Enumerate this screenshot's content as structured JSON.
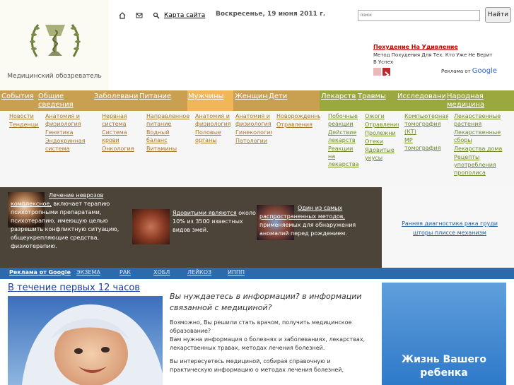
{
  "header": {
    "logo_text": "Медицинский обозреватель",
    "sitemap": "Карта сайта",
    "date": "Воскресенье, 19 июня 2011 г.",
    "search_placeholder": "поиск",
    "search_button": "Найти"
  },
  "ad_top": {
    "title": "Похудение На Удивление",
    "text": "Метод Похудения Для Тех. Кто Уже Не Верит В Успех",
    "by": "Реклама от",
    "brand": "Google"
  },
  "nav": [
    "События",
    "Общие сведения",
    "Заболевания",
    "Питание",
    "Мужчины",
    "Женщины",
    "Дети",
    "Лекарства",
    "Травмы",
    "Исследования",
    "Народная медицина"
  ],
  "subnav": [
    [
      "Новости",
      "Тенденции"
    ],
    [
      "Анатомия и физиология",
      "Генетика",
      "Эндокринная система"
    ],
    [
      "Нервная система",
      "Система крови",
      "Онкология"
    ],
    [
      "Направленное питание",
      "Водный баланс",
      "Витамины"
    ],
    [
      "Анатомия и физиология",
      "Половые органы"
    ],
    [
      "Анатомия и физиология",
      "Гинекология",
      "Патологии"
    ],
    [
      "Новорожденные",
      "Отравления"
    ],
    [
      "Побочные реакции",
      "Действие лекарств",
      "Реакции на лекарства"
    ],
    [
      "Ожоги",
      "Отравления",
      "Пролежни",
      "Отеки",
      "Ядовитые укусы"
    ],
    [
      "Компьютерная томография (КТ)",
      "МР томография"
    ],
    [
      "Лекарственные растения",
      "Лекарственные сборы",
      "Лекарства дома",
      "Рецепты употребления прополиса"
    ]
  ],
  "feature": {
    "item1_link": "Лечение неврозов комплексное,",
    "item1_text": " включает терапию психотропными препаратами, психотерапию, имеющую целью разрешить конфликтную ситуацию, общеукрепляющие средства, физиотерапию.",
    "item2_link": "Ядовитыми являются",
    "item2_text": " около 10% из 3500 известных видов змей.",
    "item3_link": "Один из самых распространенных методов,",
    "item3_text": " применяемых для обнаружения аномалий перед рождением.",
    "right_link": "Ранняя диагностика рака груди шторы плиссе механизм"
  },
  "adstrip": [
    "Реклама от Google",
    "ЭКЗЕМА",
    "РАК",
    "ХОБЛ",
    "ЛЕЙКОЗ",
    "ИППП"
  ],
  "content": {
    "headline": "В течение первых 12 часов",
    "question": "Вы нуждаетесь в информации? в информации связанной с медициной?",
    "p1": "Возможно, Вы решили стать врачом, получить медицинское образование?",
    "p1b": "Вам нужна информация о болезнях и заболеваниях, лекарствах, лекарственных травах, методах лечения болезней.",
    "p2": "Вы интересуетесь медициной, собирая справочную и практическую информацию о методах лечения болезней,",
    "promo": "Жизнь Вашего ребенка"
  },
  "colors": {
    "nav_bg": "#c99f52",
    "nav_right_bg": "#9aa83e",
    "feature_bg": "#4c4439",
    "adstrip_bg": "#2b6bab"
  }
}
